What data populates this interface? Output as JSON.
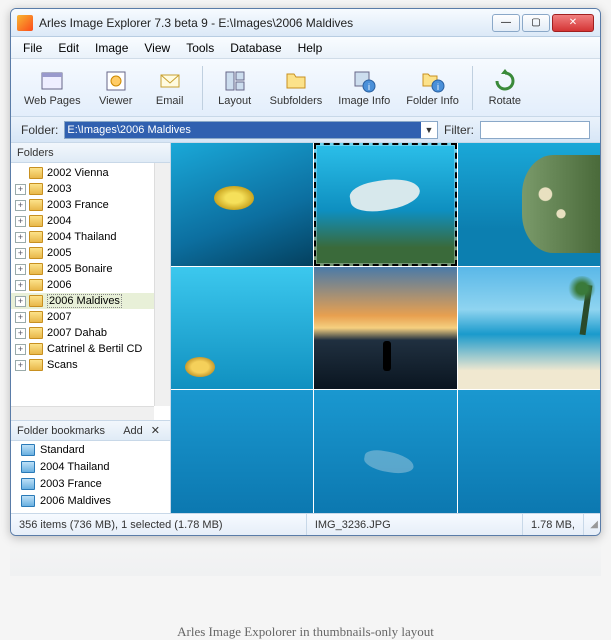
{
  "window": {
    "title": "Arles Image Explorer 7.3 beta 9 - E:\\Images\\2006 Maldives"
  },
  "menu": [
    "File",
    "Edit",
    "Image",
    "View",
    "Tools",
    "Database",
    "Help"
  ],
  "toolbar": [
    {
      "label": "Web Pages"
    },
    {
      "label": "Viewer"
    },
    {
      "label": "Email"
    },
    {
      "label": "Layout"
    },
    {
      "label": "Subfolders"
    },
    {
      "label": "Image Info"
    },
    {
      "label": "Folder Info"
    },
    {
      "label": "Rotate"
    }
  ],
  "pathbar": {
    "folder_label": "Folder:",
    "path": "E:\\Images\\2006 Maldives",
    "filter_label": "Filter:",
    "filter_value": ""
  },
  "folders": {
    "title": "Folders",
    "items": [
      {
        "label": "2002 Vienna",
        "exp": ""
      },
      {
        "label": "2003",
        "exp": "+"
      },
      {
        "label": "2003 France",
        "exp": "+"
      },
      {
        "label": "2004",
        "exp": "+"
      },
      {
        "label": "2004 Thailand",
        "exp": "+"
      },
      {
        "label": "2005",
        "exp": "+"
      },
      {
        "label": "2005 Bonaire",
        "exp": "+"
      },
      {
        "label": "2006",
        "exp": "+"
      },
      {
        "label": "2006 Maldives",
        "exp": "+",
        "sel": true
      },
      {
        "label": "2007",
        "exp": "+"
      },
      {
        "label": "2007 Dahab",
        "exp": "+"
      },
      {
        "label": "Catrinel & Bertil CD",
        "exp": "+"
      },
      {
        "label": "Scans",
        "exp": "+"
      }
    ]
  },
  "bookmarks": {
    "title": "Folder bookmarks",
    "add_label": "Add",
    "items": [
      "Standard",
      "2004 Thailand",
      "2003 France",
      "2006 Maldives"
    ]
  },
  "status": {
    "summary": "356 items (736 MB), 1 selected (1.78 MB)",
    "filename": "IMG_3236.JPG",
    "size": "1.78 MB,"
  },
  "caption": "Arles Image Expolorer in thumbnails-only layout"
}
